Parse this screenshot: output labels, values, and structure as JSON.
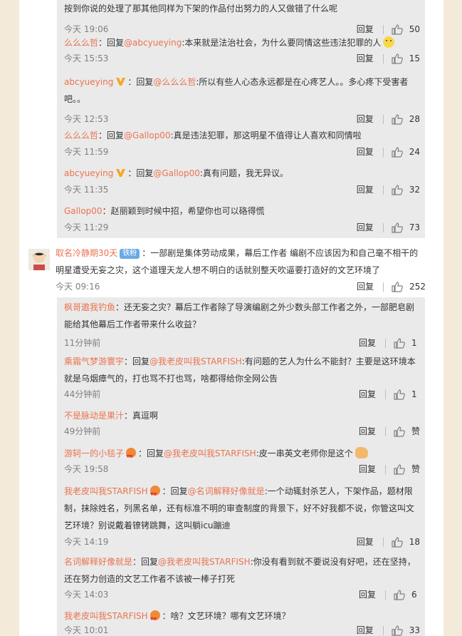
{
  "comments": [
    {
      "user": "",
      "sep": "",
      "text": "按到你说的处理了那其他同样为下架的作品付出努力的人又做错了什么呢",
      "time": "今天 19:06",
      "reply": "回复",
      "likes": "50"
    },
    {
      "user": "么么么哲",
      "sep": "：回复",
      "mention": "@abcyueying",
      "text": ":本来就是法治社会，为什么要同情这些违法犯罪的人",
      "emoji": "smile-face",
      "time": "今天 15:53",
      "reply": "回复",
      "likes": "15"
    },
    {
      "user": "abcyueying",
      "badge": "vip-v",
      "sep": "：回复",
      "mention": "@么么么哲",
      "text": ":所以有些人心态永远都是在心疼艺人。。多心疼下受害者吧。。",
      "time": "今天 12:53",
      "reply": "回复",
      "likes": "28"
    },
    {
      "user": "么么么哲",
      "sep": "：回复",
      "mention": "@Gallop00",
      "text": ":真是违法犯罪，那这明星不值得让人喜欢和同情啦",
      "time": "今天 11:59",
      "reply": "回复",
      "likes": "24"
    },
    {
      "user": "abcyueying",
      "badge": "vip-v",
      "sep": "：回复",
      "mention": "@Gallop00",
      "text": ":真有问题，我无异议。",
      "time": "今天 11:35",
      "reply": "回复",
      "likes": "32"
    },
    {
      "user": "Gallop00",
      "sep": "",
      "text": "：赵丽颖到时候中招，希望你也可以硌得慌",
      "time": "今天 11:29",
      "reply": "回复",
      "likes": "73"
    },
    {
      "user": "取名冷静期30天",
      "fan_badge": "铁粉",
      "sep": "",
      "text": "：一部剧是集体劳动成果，幕后工作者 编剧不应该因为和自己毫不相干的明星遭受无妄之灾，这个道理天龙人想不明白的话就别整天吹逼要打造好的文艺环境了",
      "time": "今天 09:16",
      "reply": "回复",
      "likes": "252"
    },
    {
      "user": "枫哥遨我钓鱼",
      "sep": "",
      "text": "：还无妄之灾？幕后工作者除了导演编剧之外少数头部工作者之外，一部肥皂剧能给其他幕后工作者带来什么收益？",
      "time": "11分钟前",
      "reply": "回复",
      "likes": "1"
    },
    {
      "user": "乘霜气梦游寰宇",
      "sep": "：回复",
      "mention": "@我老皮叫我STARFISH",
      "text": ":有问题的艺人为什么不能封？主要是这环境本就是乌烟瘴气的，打也骂不打也骂，啥都得给你全网公告",
      "time": "44分钟前",
      "reply": "回复",
      "likes": "1"
    },
    {
      "user": "不是脉动是果汁",
      "sep": "",
      "text": "：真逗啊",
      "time": "49分钟前",
      "reply": "回复",
      "likes": "赞"
    },
    {
      "user": "游轲一的小毯子",
      "emoji_badge": "hearts",
      "sep": "：回复",
      "mention": "@我老皮叫我STARFISH",
      "text": ":皮一串英文老师你是这个",
      "emoji": "thumbs-up-hand",
      "time": "今天 19:58",
      "reply": "回复",
      "likes": "赞"
    },
    {
      "user": "我老皮叫我STARFISH",
      "emoji_badge": "hearts",
      "sep": "：回复",
      "mention": "@名词解释好像就是",
      "text": ":一个动辄封杀艺人，下架作品，题材限制，抹除姓名，列黑名单，还有标准不明的审查制度的背景下，好不好我都不说，你管这叫文艺环境？别说戴着镣铐跳舞，这叫躺icu蹦迪",
      "time": "今天 14:19",
      "reply": "回复",
      "likes": "18"
    },
    {
      "user": "名词解释好像就是",
      "sep": "：回复",
      "mention": "@我老皮叫我STARFISH",
      "text": ":你没有看到就不要说没有好吧，还在坚持，还在努力创造的文艺工作者不该被一棒子打死",
      "time": "今天 14:03",
      "reply": "回复",
      "likes": "6"
    },
    {
      "user": "我老皮叫我STARFISH",
      "emoji_badge": "hearts",
      "sep": "",
      "text": "：啥？文艺环境？哪有文艺环境？",
      "time": "今天 10:01",
      "reply": "回复",
      "likes": "33"
    }
  ]
}
